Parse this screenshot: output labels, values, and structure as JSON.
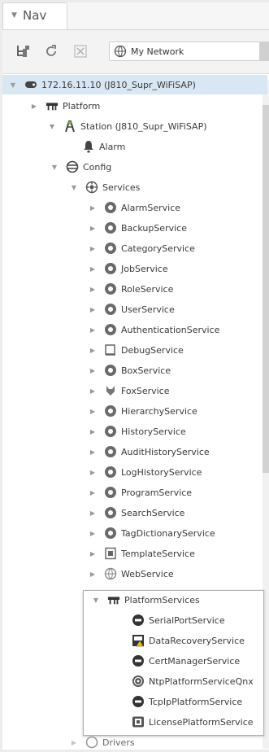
{
  "tab": {
    "label": "Nav"
  },
  "toolbar": {
    "network_select": "My Network"
  },
  "tree": {
    "root": "172.16.11.10 (J810_Supr_WiFiSAP)",
    "platform": "Platform",
    "station": "Station (J810_Supr_WiFiSAP)",
    "alarm": "Alarm",
    "config": "Config",
    "services": "Services",
    "service_items": [
      "AlarmService",
      "BackupService",
      "CategoryService",
      "JobService",
      "RoleService",
      "UserService",
      "AuthenticationService",
      "DebugService",
      "BoxService",
      "FoxService",
      "HierarchyService",
      "HistoryService",
      "AuditHistoryService",
      "LogHistoryService",
      "ProgramService",
      "SearchService",
      "TagDictionaryService",
      "TemplateService",
      "WebService"
    ],
    "platform_services": "PlatformServices",
    "platform_service_items": [
      "SerialPortService",
      "DataRecoveryService",
      "CertManagerService",
      "NtpPlatformServiceQnx",
      "TcpIpPlatformService",
      "LicensePlatformService"
    ],
    "drivers": "Drivers"
  }
}
